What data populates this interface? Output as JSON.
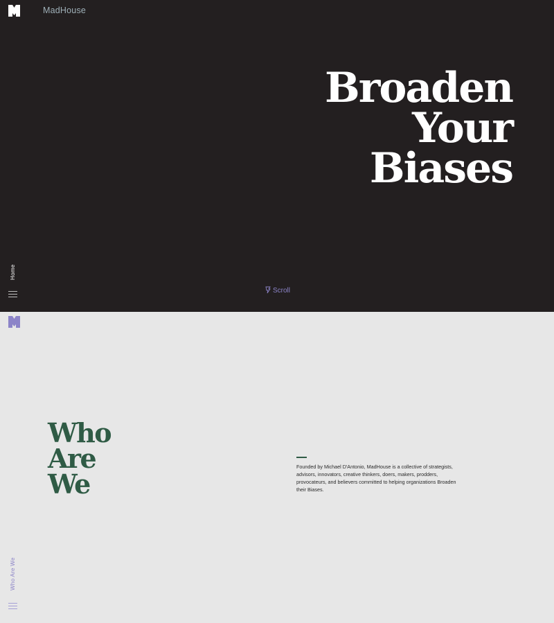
{
  "colors": {
    "hero_bg": "#231f20",
    "about_bg": "#e7e7e7",
    "brand_text": "#9fb0b8",
    "accent_purple": "#8c84c8",
    "heading_green": "#2f5b45"
  },
  "header": {
    "logo_icon": "madhouse-logo-icon",
    "brand_name": "MadHouse"
  },
  "hero": {
    "title_lines": [
      "Broaden",
      "Your",
      "Biases"
    ],
    "section_label": "Home",
    "scroll_label": "Scroll",
    "scroll_icon": "scroll-mouse-icon",
    "menu_icon": "hamburger-menu-icon"
  },
  "about": {
    "logo_icon": "madhouse-logo-icon",
    "title_lines": [
      "Who",
      "Are",
      "We"
    ],
    "description": "Founded by Michael D'Antonio, MadHouse is a collective of strategists, advisors, innovators, creative thinkers, doers, makers, prodders, provocateurs, and believers committed to helping organizations Broaden their Biases.",
    "section_label": "Who Are We",
    "menu_icon": "hamburger-menu-icon"
  }
}
